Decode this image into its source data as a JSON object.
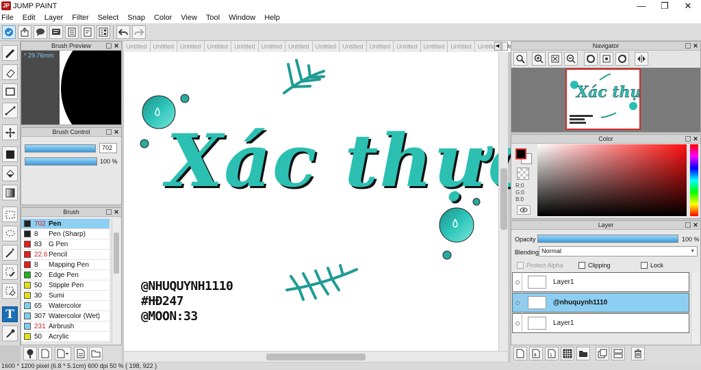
{
  "app": {
    "title": "JUMP PAINT"
  },
  "menu": [
    "File",
    "Edit",
    "Layer",
    "Filter",
    "Select",
    "Snap",
    "Color",
    "View",
    "Tool",
    "Window",
    "Help"
  ],
  "brush_preview": {
    "title": "Brush Preview",
    "size": "* 29.76mm"
  },
  "brush_control": {
    "title": "Brush Control",
    "size_value": "702",
    "size_level": 1.0,
    "opacity_value": "100 %",
    "opacity_level": 1.0
  },
  "brush": {
    "title": "Brush",
    "items": [
      {
        "size": "702",
        "name": "Pen",
        "color": "#222222",
        "size_color": "#d42020"
      },
      {
        "size": "8",
        "name": "Pen (Sharp)",
        "color": "#222222",
        "size_color": "#111111"
      },
      {
        "size": "83",
        "name": "G Pen",
        "color": "#e02020",
        "size_color": "#111111"
      },
      {
        "size": "22.6",
        "name": "Pencil",
        "color": "#e02020",
        "size_color": "#d42020"
      },
      {
        "size": "8",
        "name": "Mapping Pen",
        "color": "#e02020",
        "size_color": "#111111"
      },
      {
        "size": "20",
        "name": "Edge Pen",
        "color": "#20b020",
        "size_color": "#111111"
      },
      {
        "size": "50",
        "name": "Stipple Pen",
        "color": "#e0e020",
        "size_color": "#111111"
      },
      {
        "size": "30",
        "name": "Sumi",
        "color": "#e0e020",
        "size_color": "#111111"
      },
      {
        "size": "65",
        "name": "Watercolor",
        "color": "#7fd0f0",
        "size_color": "#111111"
      },
      {
        "size": "307",
        "name": "Watercolor (Wet)",
        "color": "#7fd0f0",
        "size_color": "#111111"
      },
      {
        "size": "231",
        "name": "Airbrush",
        "color": "#7fd0f0",
        "size_color": "#d42020"
      },
      {
        "size": "50",
        "name": "Acrylic",
        "color": "#e0e020",
        "size_color": "#111111"
      }
    ]
  },
  "tabs": [
    "Untitled",
    "Untitled",
    "Untitled",
    "Untitled",
    "Untitled",
    "Untitled",
    "Untitled",
    "Untitled",
    "Untitled",
    "Untitled",
    "Untitled",
    "Untitled",
    "Untitled",
    "Untitled",
    "Untitled"
  ],
  "canvas_art": {
    "title_text": "Xác thực",
    "handles": [
      "@NHUQUYNH1110",
      "#HĐ247",
      "@MOON:33"
    ],
    "accent": "#2bbfb4"
  },
  "navigator": {
    "title": "Navigator"
  },
  "color": {
    "title": "Color",
    "r": "R:0",
    "g": "G:0",
    "b": "B:0"
  },
  "layer": {
    "title": "Layer",
    "opacity_label": "Opacity",
    "opacity_value": "100 %",
    "opacity_level": 1.0,
    "blending_label": "Blending",
    "blending_value": "Normal",
    "protect_alpha": "Protect Alpha",
    "clipping": "Clipping",
    "lock": "Lock",
    "items": [
      {
        "name": "Layer1",
        "selected": false
      },
      {
        "name": "@nhuquynh1110",
        "selected": true
      },
      {
        "name": "Layer1",
        "selected": false
      }
    ]
  },
  "status": "1600 * 1200 pixel   (6.8 * 5.1cm)   600 dpi   50 %   ( 198, 922 )"
}
